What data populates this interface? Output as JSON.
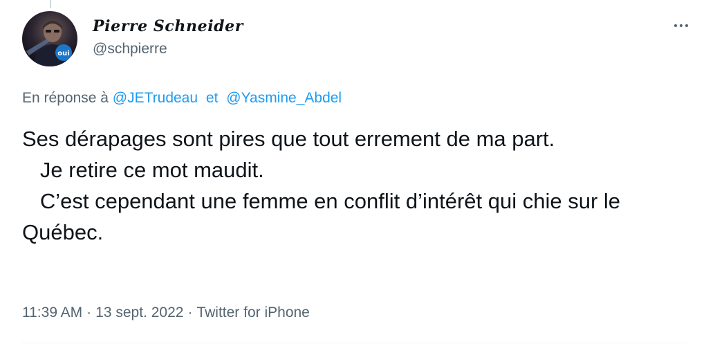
{
  "author": {
    "display_name": "Pierre Schneider",
    "handle": "@schpierre",
    "avatar_badge": "oui"
  },
  "reply": {
    "prefix": "En réponse à",
    "mention_1": "@JETrudeau",
    "connector": "et",
    "mention_2": "@Yasmine_Abdel"
  },
  "tweet": {
    "text": "Ses dérapages sont pires que tout errement de ma part.\n   Je retire ce mot maudit.\n   C’est cependant une femme en conflit d’intérêt qui chie sur le Québec."
  },
  "meta": {
    "time": "11:39 AM",
    "date": "13 sept. 2022",
    "source": "Twitter for iPhone",
    "separator": "·"
  },
  "icons": {
    "more": "more-horizontal-icon"
  },
  "colors": {
    "link": "#1d9bf0",
    "secondary_text": "#536471",
    "primary_text": "#0f1419",
    "divider": "#eff3f4"
  }
}
